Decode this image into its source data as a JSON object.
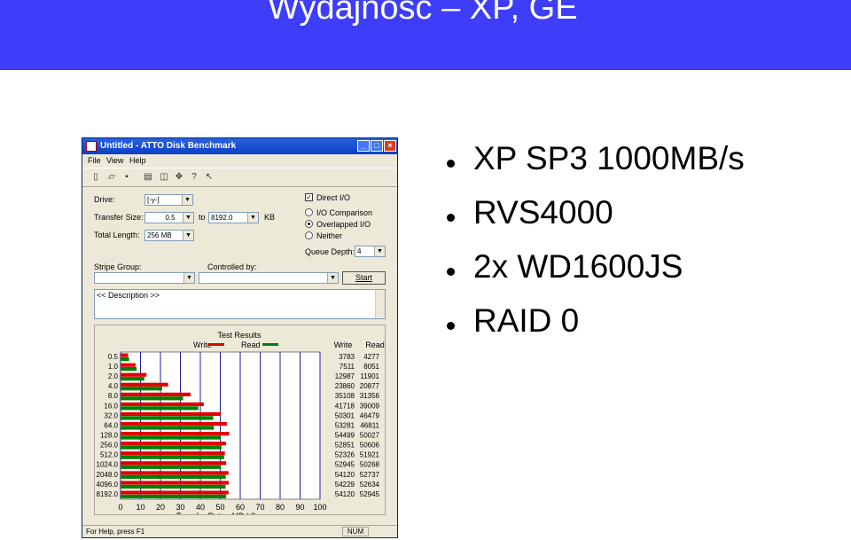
{
  "slide": {
    "title": "Wydajność – XP, GE",
    "bullets": [
      "XP SP3 1000MB/s",
      "RVS4000",
      "2x WD1600JS",
      "RAID 0"
    ]
  },
  "window": {
    "title": "Untitled - ATTO Disk Benchmark",
    "menu": [
      "File",
      "View",
      "Help"
    ],
    "toolbar_icons": [
      "new-icon",
      "open-icon",
      "save-icon",
      "print-icon",
      "print-preview-icon",
      "move-icon",
      "help-icon",
      "context-help-icon"
    ],
    "drive_label": "Drive:",
    "drive_value": "[-y-]",
    "transfer_size_label": "Transfer Size:",
    "transfer_from": "0.5",
    "to_label": "to",
    "transfer_to": "8192.0",
    "kb_label": "KB",
    "total_length_label": "Total Length:",
    "total_length_value": "256 MB",
    "direct_io_label": "Direct I/O",
    "direct_io_checked": true,
    "io_modes": [
      "I/O Comparison",
      "Overlapped I/O",
      "Neither"
    ],
    "io_mode_selected": 1,
    "queue_depth_label": "Queue Depth:",
    "queue_depth_value": "4",
    "stripe_group_label": "Stripe Group:",
    "controlled_by_label": "Controlled by:",
    "start_label": "Start",
    "description_text": "<< Description >>",
    "status_text": "For Help, press F1",
    "status_num": "NUM"
  },
  "chart_data": {
    "type": "bar",
    "title": "Test Results",
    "xlabel": "Transfer Rate - MB / Sec",
    "xlim": [
      0,
      100
    ],
    "xticks": [
      0,
      10,
      20,
      30,
      40,
      50,
      60,
      70,
      80,
      90,
      100
    ],
    "categories": [
      "0.5",
      "1.0",
      "2.0",
      "4.0",
      "8.0",
      "16.0",
      "32.0",
      "64.0",
      "128.0",
      "256.0",
      "512.0",
      "1024.0",
      "2048.0",
      "4096.0",
      "8192.0"
    ],
    "series": [
      {
        "name": "Write",
        "color": "#e00000",
        "values": [
          3783,
          7511,
          12987,
          23860,
          35108,
          41718,
          50301,
          53281,
          54499,
          52851,
          52326,
          52945,
          54120,
          54229,
          54120
        ]
      },
      {
        "name": "Read",
        "color": "#008000",
        "values": [
          4277,
          8051,
          11901,
          20877,
          31356,
          39009,
          46479,
          46811,
          50027,
          50606,
          51921,
          50268,
          52737,
          52634,
          52945
        ]
      }
    ],
    "value_headers": [
      "Write",
      "Read"
    ]
  }
}
